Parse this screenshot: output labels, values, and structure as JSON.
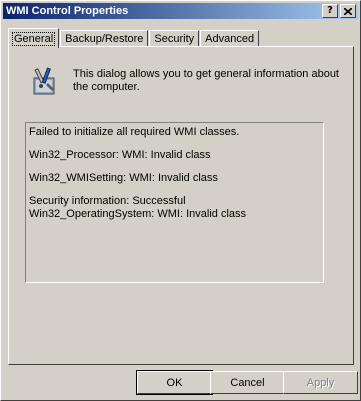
{
  "window": {
    "title": "WMI Control Properties"
  },
  "title_buttons": {
    "help": "?",
    "close": "X"
  },
  "tabs": [
    {
      "label": "General",
      "active": true
    },
    {
      "label": "Backup/Restore",
      "active": false
    },
    {
      "label": "Security",
      "active": false
    },
    {
      "label": "Advanced",
      "active": false
    }
  ],
  "general": {
    "icon": "wmi-tools-icon",
    "description": "This dialog allows you to get general information about the computer.",
    "info_lines": [
      "Failed to initialize all required WMI classes.",
      "Win32_Processor:  WMI: Invalid class",
      "Win32_WMISetting:  WMI: Invalid class",
      "Security information: Successful",
      "Win32_OperatingSystem:  WMI: Invalid class"
    ]
  },
  "buttons": {
    "ok": "OK",
    "cancel": "Cancel",
    "apply": "Apply"
  }
}
